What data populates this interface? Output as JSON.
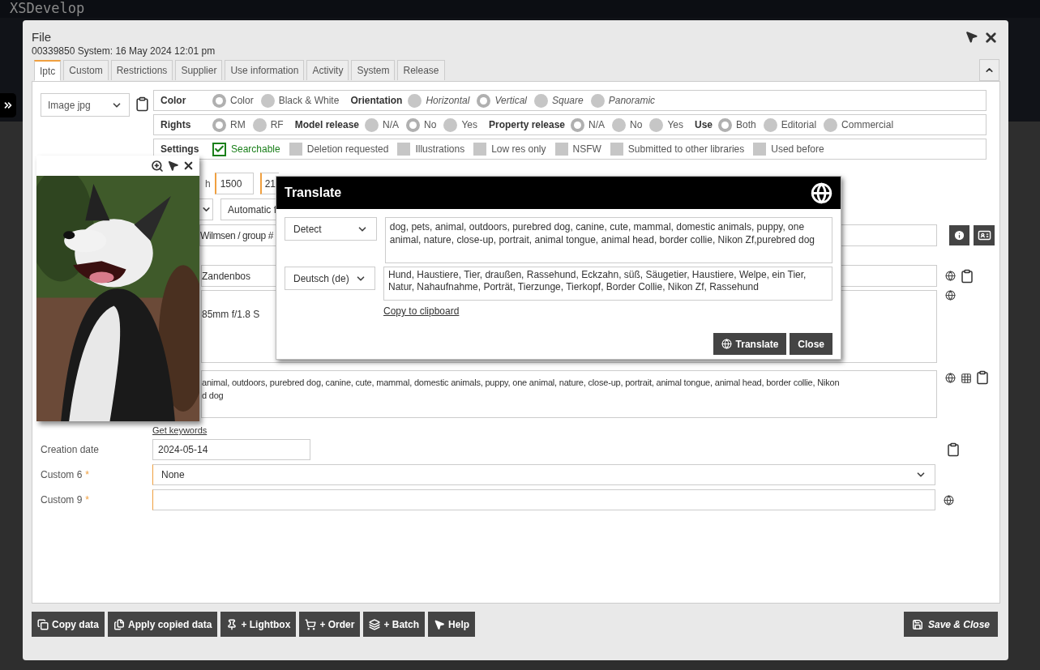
{
  "app": {
    "title": "XSDevelop"
  },
  "dialog": {
    "title": "File",
    "subtitle": "00339850 System: 16 May 2024 12:01 pm"
  },
  "tabs": [
    {
      "label": "Iptc",
      "selected": true
    },
    {
      "label": "Custom",
      "selected": false
    },
    {
      "label": "Restrictions",
      "selected": false
    },
    {
      "label": "Supplier",
      "selected": false
    },
    {
      "label": "Use information",
      "selected": false
    },
    {
      "label": "Activity",
      "selected": false
    },
    {
      "label": "System",
      "selected": false
    },
    {
      "label": "Release",
      "selected": false
    }
  ],
  "file_type": {
    "value": "Image jpg"
  },
  "option_groups": [
    {
      "label": "Color",
      "kind": "radio",
      "sections": [
        {
          "options": [
            {
              "label": "Color",
              "selected": true
            },
            {
              "label": "Black & White",
              "selected": false
            }
          ]
        },
        {
          "label": "Orientation",
          "italic": true,
          "options": [
            {
              "label": "Horizontal",
              "selected": false
            },
            {
              "label": "Vertical",
              "selected": true
            },
            {
              "label": "Square",
              "selected": false
            },
            {
              "label": "Panoramic",
              "selected": false
            }
          ]
        }
      ]
    },
    {
      "label": "Rights",
      "kind": "radio",
      "sections": [
        {
          "options": [
            {
              "label": "RM",
              "selected": true
            },
            {
              "label": "RF",
              "selected": false
            }
          ]
        },
        {
          "label": "Model release",
          "options": [
            {
              "label": "N/A",
              "selected": false
            },
            {
              "label": "No",
              "selected": true
            },
            {
              "label": "Yes",
              "selected": false
            }
          ]
        },
        {
          "label": "Property release",
          "options": [
            {
              "label": "N/A",
              "selected": true
            },
            {
              "label": "No",
              "selected": false
            },
            {
              "label": "Yes",
              "selected": false
            }
          ]
        },
        {
          "label": "Use",
          "options": [
            {
              "label": "Both",
              "selected": true
            },
            {
              "label": "Editorial",
              "selected": false
            },
            {
              "label": "Commercial",
              "selected": false
            }
          ]
        }
      ]
    },
    {
      "label": "Settings",
      "kind": "checkbox",
      "sections": [
        {
          "options": [
            {
              "label": "Searchable",
              "checked": true
            },
            {
              "label": "Deletion requested",
              "checked": false
            },
            {
              "label": "Illustrations",
              "checked": false
            },
            {
              "label": "Low res only",
              "checked": false
            },
            {
              "label": "NSFW",
              "checked": false
            },
            {
              "label": "Submitted to other libraries",
              "checked": false
            },
            {
              "label": "Used before",
              "checked": false
            }
          ]
        }
      ]
    }
  ],
  "dimensions": {
    "label": "h",
    "values": [
      "1500",
      "21"
    ]
  },
  "automatic_field": {
    "value": "Automatic f"
  },
  "author_field": {
    "value": "Wilmsen / group #"
  },
  "location_field": {
    "value": "Zandenbos"
  },
  "description_field": {
    "value": "85mm f/1.8 S"
  },
  "keywords": {
    "lines": [
      "animal, outdoors, purebred dog, canine, cute, mammal, domestic animals, puppy, one animal, nature, close-up, portrait, animal tongue, animal head, border collie, Nikon",
      "d dog"
    ],
    "link": "Get keywords"
  },
  "fields": [
    {
      "label": "Creation date",
      "kind": "text",
      "value": "2024-05-14"
    },
    {
      "label": "Custom 6",
      "mark": "*",
      "kind": "select",
      "value": "None"
    },
    {
      "label": "Custom 9",
      "mark": "*",
      "kind": "text"
    }
  ],
  "translate": {
    "title": "Translate",
    "source": {
      "language": "Detect",
      "text": "dog, pets, animal, outdoors, purebred dog, canine, cute, mammal, domestic animals, puppy, one animal, nature, close-up, portrait, animal tongue, animal head, border collie, Nikon Zf,purebred dog"
    },
    "target": {
      "language": "Deutsch (de)",
      "text": "Hund, Haustiere, Tier, draußen, Rassehund, Eckzahn, süß, Säugetier, Haustiere, Welpe, ein Tier, Natur, Nahaufnahme, Porträt, Tierzunge, Tierkopf, Border Collie, Nikon Zf, Rassehund"
    },
    "copy_link": "Copy to clipboard",
    "buttons": [
      "Translate",
      "Close"
    ]
  },
  "toolbar_buttons": [
    "Copy data",
    "Apply copied data",
    "+ Lightbox",
    "+ Order",
    "+ Batch",
    "Help"
  ],
  "save_button": {
    "label": "Save & Close"
  }
}
